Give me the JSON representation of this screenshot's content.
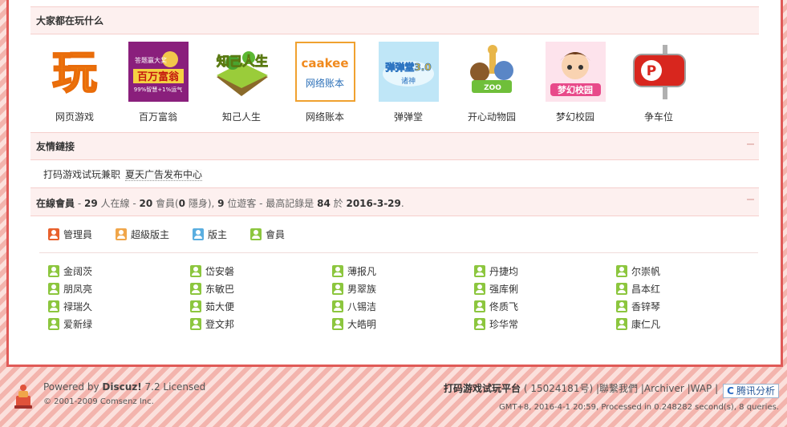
{
  "sections": {
    "games_title": "大家都在玩什么",
    "links_title": "友情鏈接",
    "online_prefix": "在線會員",
    "online_text": [
      " - ",
      "29",
      " 人在線 - ",
      "20",
      " 會員(",
      "0",
      " 隱身), ",
      "9",
      " 位遊客 - 最高記錄是 ",
      "84",
      " 於 ",
      "2016-3-29",
      "."
    ]
  },
  "games": [
    {
      "label": "网页游戏",
      "icon": "play-char-icon"
    },
    {
      "label": "百万富翁",
      "icon": "millionaire-icon"
    },
    {
      "label": "知己人生",
      "icon": "island-icon"
    },
    {
      "label": "网络账本",
      "icon": "caakee-icon"
    },
    {
      "label": "弹弹堂",
      "icon": "ddt-icon"
    },
    {
      "label": "开心动物园",
      "icon": "zoo-icon"
    },
    {
      "label": "梦幻校园",
      "icon": "school-icon"
    },
    {
      "label": "争车位",
      "icon": "parking-icon"
    }
  ],
  "links": {
    "first": "打码游戏试玩兼职",
    "second": "夏天广告发布中心"
  },
  "legend": [
    {
      "label": "管理員",
      "color": "#e8602c"
    },
    {
      "label": "超級版主",
      "color": "#f0a64a"
    },
    {
      "label": "版主",
      "color": "#5aaee0"
    },
    {
      "label": "會員",
      "color": "#8cc63e"
    }
  ],
  "members": [
    [
      "金阔茨",
      "岱安磐",
      "薄报凡",
      "丹捷均",
      "尔崇帆"
    ],
    [
      "朋凤亮",
      "东敏巴",
      "男翠族",
      "强库俐",
      "昌本红"
    ],
    [
      "禄瑞久",
      "茹大便",
      "八锡洁",
      "佟质飞",
      "香锌琴"
    ],
    [
      "爱新绿",
      "登文邦",
      "大皓明",
      "珍华常",
      "康仁凡"
    ]
  ],
  "footer": {
    "powered_prefix": "Powered by ",
    "brand": "Discuz!",
    "version": " 7.2 Licensed",
    "copyright": "© 2001-2009 Comsenz Inc.",
    "site": "打码游戏试玩平台",
    "icp": "15024181号",
    "contact": "聯繫我們",
    "archiver": "Archiver",
    "wap": "WAP",
    "stats_label": "腾讯分析",
    "status": "GMT+8, 2016-4-1 20:59, Processed in 0.248282 second(s), 8 queries."
  },
  "colors": {
    "border": "#e05a57",
    "bar_bg": "#fdf0ef"
  }
}
